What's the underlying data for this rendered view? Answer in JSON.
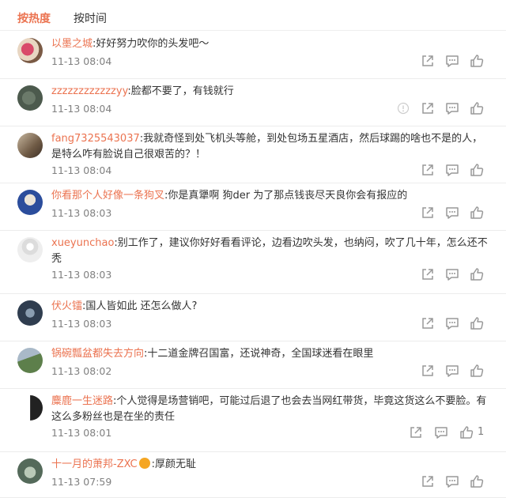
{
  "tabs": {
    "hot": "按热度",
    "time": "按时间"
  },
  "colors": {
    "accent": "#eb7350",
    "text": "#333333",
    "muted": "#808080",
    "icon": "#999999"
  },
  "comments": [
    {
      "user": "以墨之城",
      "text": ":好好努力吹你的头发吧～",
      "time": "11-13 08:04"
    },
    {
      "user": "zzzzzzzzzzzzyy",
      "text": ":脸都不要了，有钱就行",
      "time": "11-13 08:04"
    },
    {
      "user": "fang7325543037",
      "text": ":我就奇怪到处飞机头等舱，到处包场五星酒店，然后球踢的啥也不是的人，是特么咋有脸说自己很艰苦的？！",
      "time": "11-13 08:04"
    },
    {
      "user": "你看那个人好像一条狗叉",
      "text": ":你是真犟啊 狗der 为了那点钱丧尽天良你会有报应的",
      "time": "11-13 08:03"
    },
    {
      "user": "xueyunchao",
      "text": ":别工作了，建议你好好看看评论，边看边吹头发，也纳闷，吹了几十年，怎么还不秃",
      "time": "11-13 08:03"
    },
    {
      "user": "伏火镭",
      "text": ":国人皆如此 还怎么做人?",
      "time": "11-13 08:03"
    },
    {
      "user": "锅碗瓢盆都失去方向",
      "text": ":十二道金牌召国富，还说神奇，全国球迷看在眼里",
      "time": "11-13 08:02"
    },
    {
      "user": "麋鹿一生迷路",
      "text": ":个人觉得是场营销吧，可能过后退了也会去当网红带货，毕竟这货这么不要脸。有这么多粉丝也是在坐的责任",
      "time": "11-13 08:01",
      "likes": "1"
    },
    {
      "user": "十一月的萧邦-ZXC",
      "text": ":厚颜无耻",
      "time": "11-13 07:59"
    }
  ],
  "icons": {
    "share": "share-icon",
    "comment": "comment-icon",
    "like": "thumbs-up-icon",
    "report": "report-icon",
    "badge": "fan-badge-icon"
  }
}
